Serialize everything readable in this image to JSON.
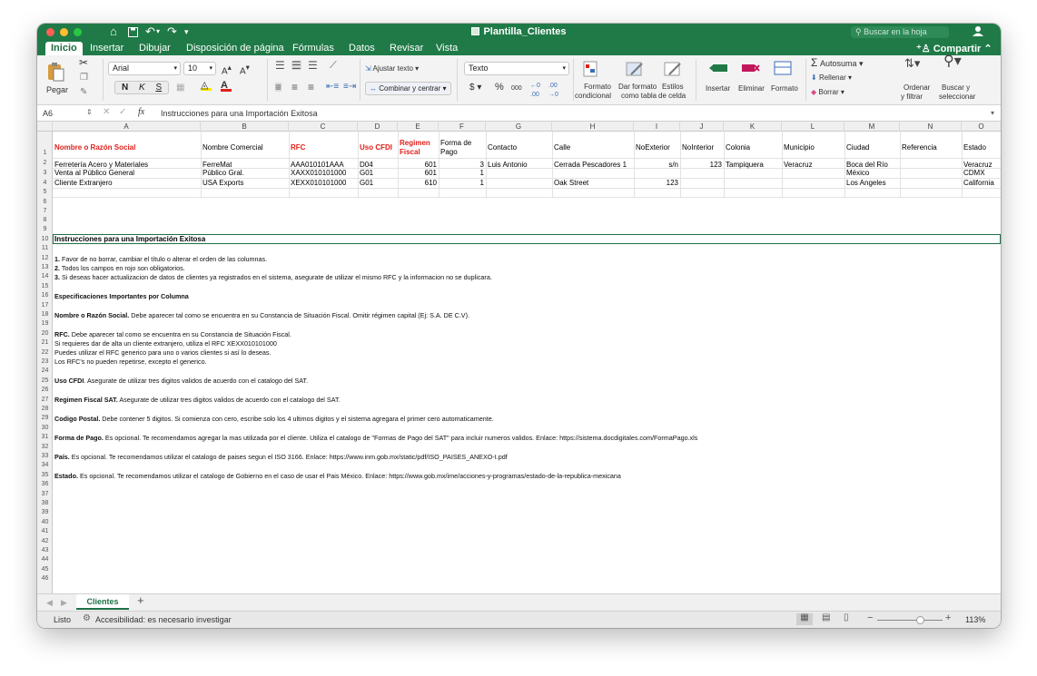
{
  "window": {
    "title": "Plantilla_Clientes"
  },
  "search": {
    "placeholder": "Buscar en la hoja"
  },
  "tabs": [
    "Inicio",
    "Insertar",
    "Dibujar",
    "Disposición de página",
    "Fórmulas",
    "Datos",
    "Revisar",
    "Vista"
  ],
  "share_label": "Compartir",
  "ribbon": {
    "paste": "Pegar",
    "font_name": "Arial",
    "font_size": "10",
    "bold": "N",
    "italic": "K",
    "underline": "S",
    "wrap_text": "Ajustar texto",
    "merge_center": "Combinar y centrar",
    "number_format": "Texto",
    "currency": "$",
    "percent": "%",
    "thousands": "000",
    "cond_format_1": "Formato",
    "cond_format_2": "condicional",
    "table_format_1": "Dar formato",
    "table_format_2": "como tabla",
    "cell_styles_1": "Estilos",
    "cell_styles_2": "de celda",
    "insert": "Insertar",
    "delete": "Eliminar",
    "format": "Formato",
    "autosum": "Autosuma",
    "fill": "Rellenar",
    "clear": "Borrar",
    "sort_1": "Ordenar",
    "sort_2": "y filtrar",
    "find_1": "Buscar y",
    "find_2": "seleccionar"
  },
  "formula_bar": {
    "cell_ref": "A6",
    "fx": "fx",
    "content": "Instrucciones para una Importación Exitosa"
  },
  "columns": [
    "A",
    "B",
    "C",
    "D",
    "E",
    "F",
    "G",
    "H",
    "I",
    "J",
    "K",
    "L",
    "M",
    "N",
    "O"
  ],
  "rows": [
    "1",
    "2",
    "3",
    "4",
    "5",
    "6",
    "7",
    "8",
    "9",
    "10",
    "11",
    "12",
    "13",
    "14",
    "15",
    "16",
    "17",
    "18",
    "19",
    "20",
    "21",
    "22",
    "23",
    "24",
    "25",
    "26",
    "27",
    "28",
    "29",
    "30",
    "31",
    "32",
    "33",
    "34",
    "35",
    "36",
    "37",
    "38",
    "39",
    "40",
    "41",
    "42",
    "43",
    "44",
    "45",
    "46"
  ],
  "headers": {
    "A": "Nombre o Razón Social",
    "B": "Nombre Comercial",
    "C": "RFC",
    "D": "Uso CFDI",
    "E1": "Regimen",
    "E2": "Fiscal",
    "F1": "Forma de",
    "F2": "Pago",
    "G": "Contacto",
    "H": "Calle",
    "I": "NoExterior",
    "J": "NoInterior",
    "K": "Colonia",
    "L": "Municipio",
    "M": "Ciudad",
    "N": "Referencia",
    "O": "Estado"
  },
  "data_rows": [
    [
      "Ferretería Acero y Materiales",
      "FerreMat",
      "AAA010101AAA",
      "D04",
      "601",
      "3",
      "Luis Antonio",
      "Cerrada Pescadores 1",
      "s/n",
      "123",
      "Tampiquera",
      "Veracruz",
      "Boca del Río",
      "",
      "Veracruz"
    ],
    [
      "Venta al Público General",
      "Público Gral.",
      "XAXX010101000",
      "G01",
      "601",
      "1",
      "",
      "",
      "",
      "",
      "",
      "",
      "México",
      "",
      "CDMX"
    ],
    [
      "Cliente Extranjero",
      "USA Exports",
      "XEXX010101000",
      "G01",
      "610",
      "1",
      "",
      "Oak Street",
      "123",
      "",
      "",
      "",
      "Los Angeles",
      "",
      "California"
    ]
  ],
  "instructions": {
    "title": "Instrucciones para una Importación Exitosa",
    "l8_num": "1.",
    "l8": " Favor de no borrar, cambiar el título o alterar el orden de las columnas.",
    "l9_num": "2.",
    "l9": " Todos los campos en rojo son obligatorios.",
    "l10_num": "3.",
    "l10": " Si deseas hacer actualizacion de datos de clientes ya registrados en el sistema, asegurate de utilizar el mismo RFC y la informacion no se duplicara.",
    "l12": "Especificaciones Importantes por Columna",
    "l14_b": "Nombre o Razón Social.",
    "l14": " Debe aparecer tal como se encuentra en su Constancia de Situación Fiscal. Omitir régimen capital (Ej: S.A. DE C.V).",
    "l16_b": "RFC.",
    "l16": " Debe aparecer tal como se encuentra en su Constancia de Situación Fiscal.",
    "l17": "Si requieres dar de alta un cliente extranjero, utiliza el RFC XEXX010101000",
    "l18": "Puedes utilizar el RFC generico para uno o varios clientes si así lo deseas.",
    "l19": "Los RFC's no pueden repetirse, excepto el generico.",
    "l21_b": "Uso CFDI",
    "l21": ". Asegurate de utilizar tres digitos validos de acuerdo con el catalogo del SAT.",
    "l23_b": "Regimen Fiscal SAT.",
    "l23": " Asegurate de utilizar tres digitos validos de acuerdo con el catalogo del SAT.",
    "l25_b": "Codigo Postal.",
    "l25": " Debe contener 5 digitos. Si comienza con cero, escribe solo los 4 ultimos digitos y el sistema agregara el primer cero automaticamente.",
    "l27_b": "Forma de Pago.",
    "l27": " Es opcional. Te recomendamos agregar la mas utilizada por el cliente. Utiliza el catalogo de \"Formas de Pago del SAT\" para incluir numeros validos. Enlace: https://sistema.docdigitales.com/FormaPago.xls",
    "l29_b": "País.",
    "l29": " Es opcional. Te recomendamos utilizar el catalogo de paises segun el ISO 3166. Enlace: https://www.inm.gob.mx/static/pdf/ISO_PAISES_ANEXO-I.pdf",
    "l31_b": "Estado.",
    "l31": " Es opcional. Te recomendamos utilizar el catalogo de Gobierno en el caso de usar el Pais México. Enlace: https://www.gob.mx/ime/acciones-y-programas/estado-de-la-republica-mexicana"
  },
  "sheet_tab": "Clientes",
  "status": {
    "ready": "Listo",
    "accessibility": "Accesibilidad: es necesario investigar",
    "zoom": "113%"
  },
  "colors": {
    "accent": "#1f7a47",
    "required": "#e0201b"
  }
}
